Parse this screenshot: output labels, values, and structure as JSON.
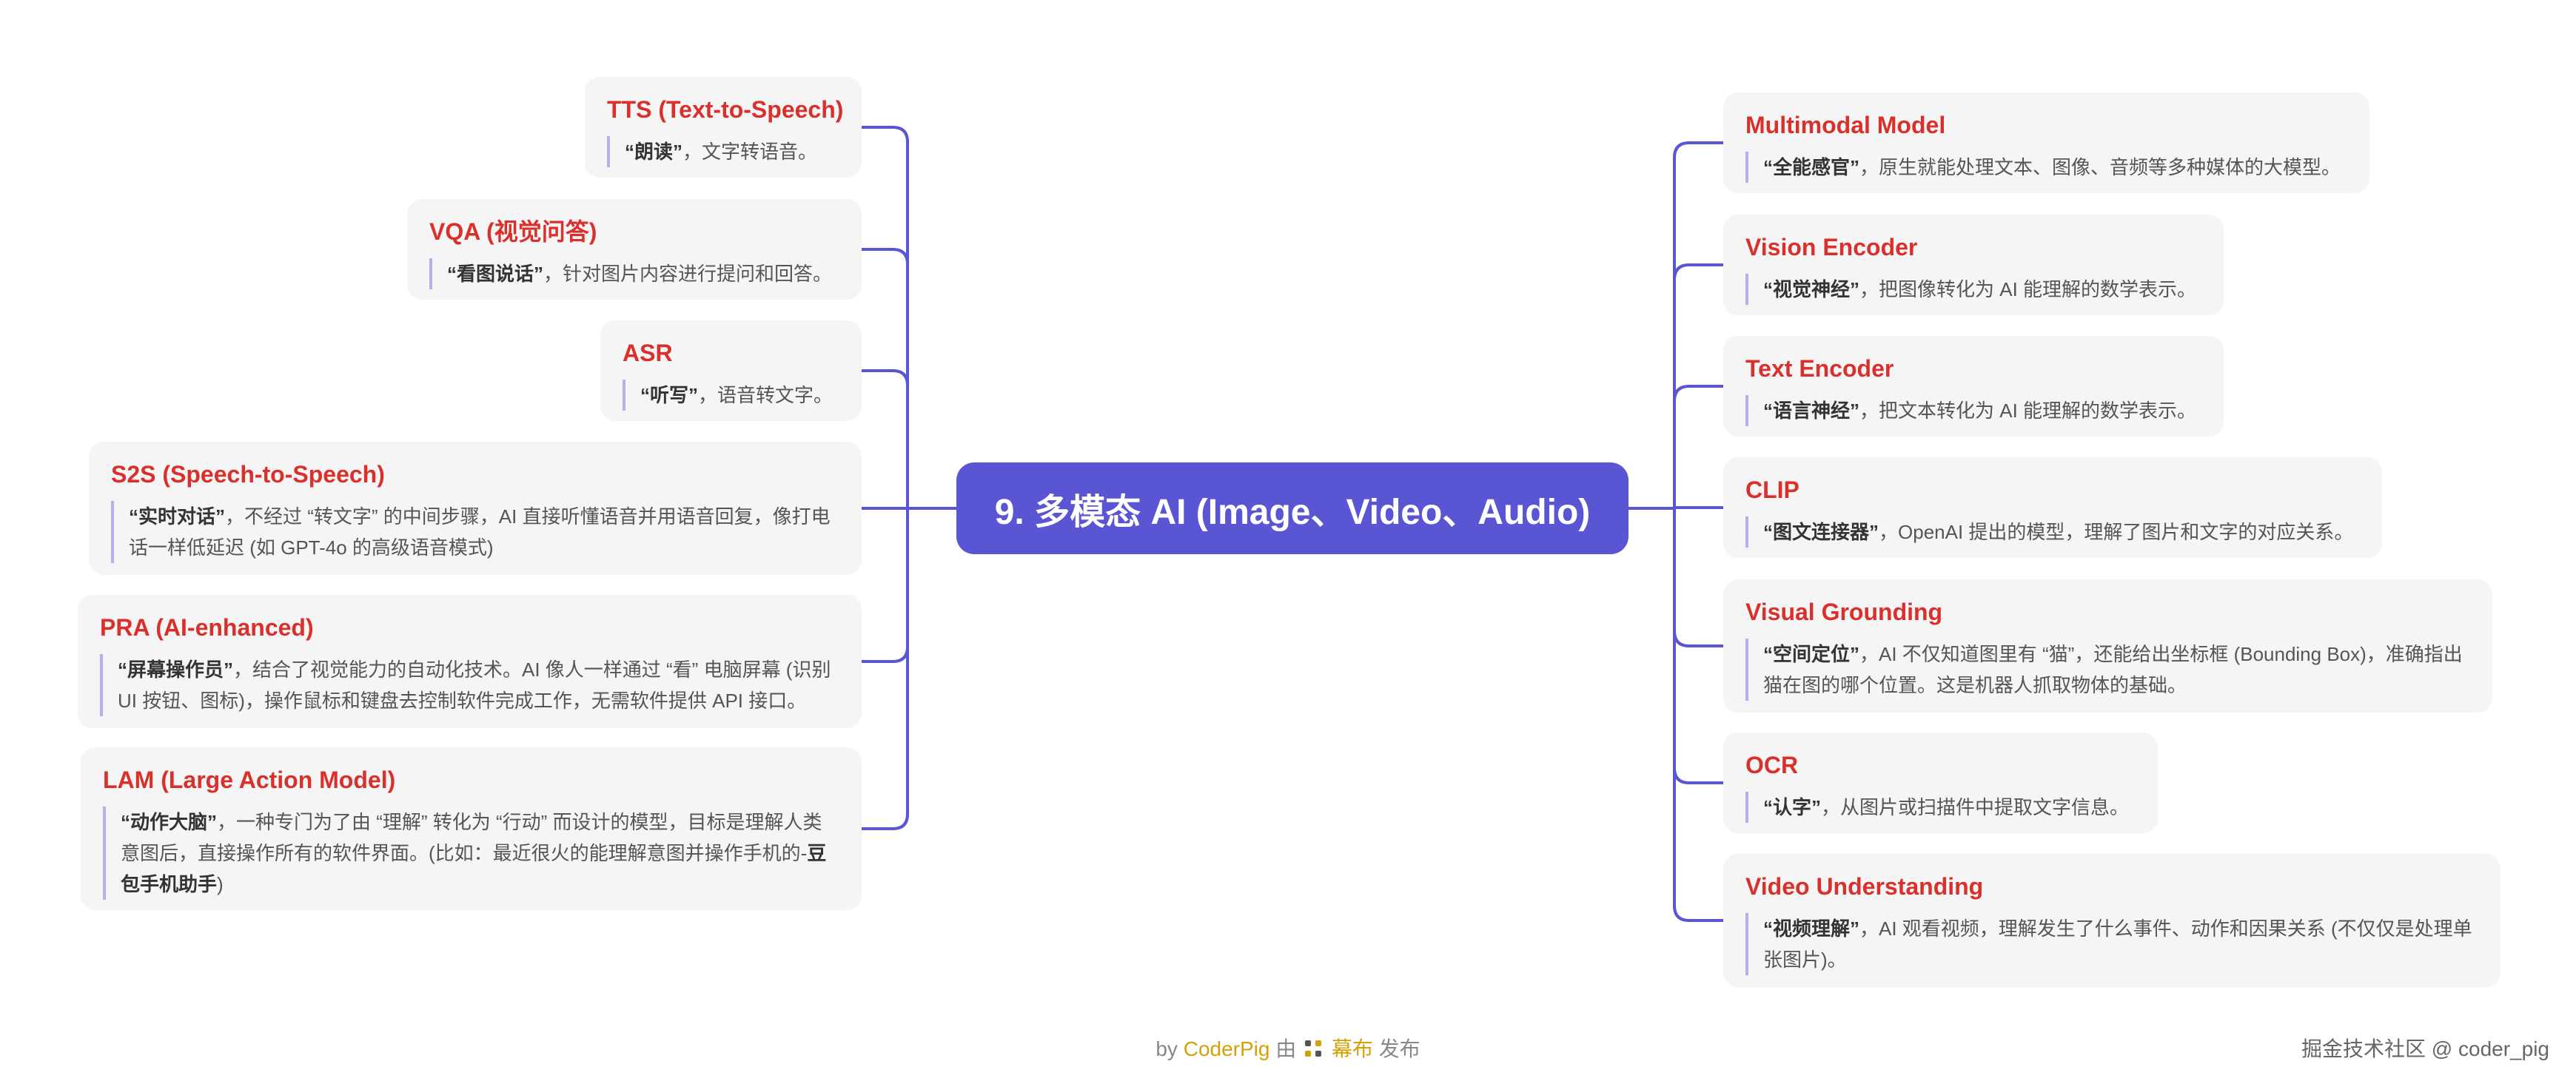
{
  "center": {
    "title": "9. 多模态 AI (Image、Video、Audio)"
  },
  "left_nodes": [
    {
      "title": "TTS (Text-to-Speech)",
      "desc": [
        {
          "b": "“朗读”"
        },
        {
          "t": "，文字转语音。"
        }
      ]
    },
    {
      "title": "VQA (视觉问答)",
      "desc": [
        {
          "b": "“看图说话”"
        },
        {
          "t": "，针对图片内容进行提问和回答。"
        }
      ]
    },
    {
      "title": "ASR",
      "desc": [
        {
          "b": "“听写”"
        },
        {
          "t": "，语音转文字。"
        }
      ]
    },
    {
      "title": "S2S (Speech-to-Speech)",
      "desc": [
        {
          "b": "“实时对话”"
        },
        {
          "t": "，不经过 “转文字” 的中间步骤，AI 直接听懂语音并用语音回复，像打电话一样低延迟 (如 GPT-4o 的高级语音模式)"
        }
      ]
    },
    {
      "title": "PRA (AI-enhanced)",
      "desc": [
        {
          "b": "“屏幕操作员”"
        },
        {
          "t": "，结合了视觉能力的自动化技术。AI 像人一样通过 “看” 电脑屏幕 (识别 UI 按钮、图标)，操作鼠标和键盘去控制软件完成工作，无需软件提供 API 接口。"
        }
      ]
    },
    {
      "title": "LAM (Large Action Model)",
      "desc": [
        {
          "b": "“动作大脑”"
        },
        {
          "t": "，一种专门为了由 “理解” 转化为 “行动” 而设计的模型，目标是理解人类意图后，直接操作所有的软件界面。(比如：最近很火的能理解意图并操作手机的-"
        },
        {
          "b": "豆包手机助手"
        },
        {
          "t": ")"
        }
      ]
    }
  ],
  "right_nodes": [
    {
      "title": "Multimodal Model",
      "desc": [
        {
          "b": "“全能感官”"
        },
        {
          "t": "，原生就能处理文本、图像、音频等多种媒体的大模型。"
        }
      ]
    },
    {
      "title": "Vision Encoder",
      "desc": [
        {
          "b": "“视觉神经”"
        },
        {
          "t": "，把图像转化为 AI 能理解的数学表示。"
        }
      ]
    },
    {
      "title": "Text Encoder",
      "desc": [
        {
          "b": "“语言神经”"
        },
        {
          "t": "，把文本转化为 AI 能理解的数学表示。"
        }
      ]
    },
    {
      "title": "CLIP",
      "desc": [
        {
          "b": "“图文连接器”"
        },
        {
          "t": "，OpenAI 提出的模型，理解了图片和文字的对应关系。"
        }
      ]
    },
    {
      "title": "Visual Grounding",
      "desc": [
        {
          "b": "“空间定位”"
        },
        {
          "t": "，AI 不仅知道图里有 “猫”，还能给出坐标框 (Bounding Box)，准确指出猫在图的哪个位置。这是机器人抓取物体的基础。"
        }
      ]
    },
    {
      "title": "OCR",
      "desc": [
        {
          "b": "“认字”"
        },
        {
          "t": "，从图片或扫描件中提取文字信息。"
        }
      ]
    },
    {
      "title": "Video Understanding",
      "desc": [
        {
          "b": "“视频理解”"
        },
        {
          "t": "，AI 观看视频，理解发生了什么事件、动作和因果关系 (不仅仅是处理单张图片)。"
        }
      ]
    }
  ],
  "footer": {
    "by": "by",
    "author": "CoderPig",
    "mid": "由",
    "brand": "幕布",
    "tail": "发布"
  },
  "watermark": "掘金技术社区 @ coder_pig",
  "colors": {
    "center_fill": "#5a55d2",
    "line": "#5a55d2",
    "title_red": "#d9302c",
    "node_bg": "#f5f5f5",
    "quote_bar": "#b3b0ec",
    "footer_accent": "#d3a208"
  }
}
